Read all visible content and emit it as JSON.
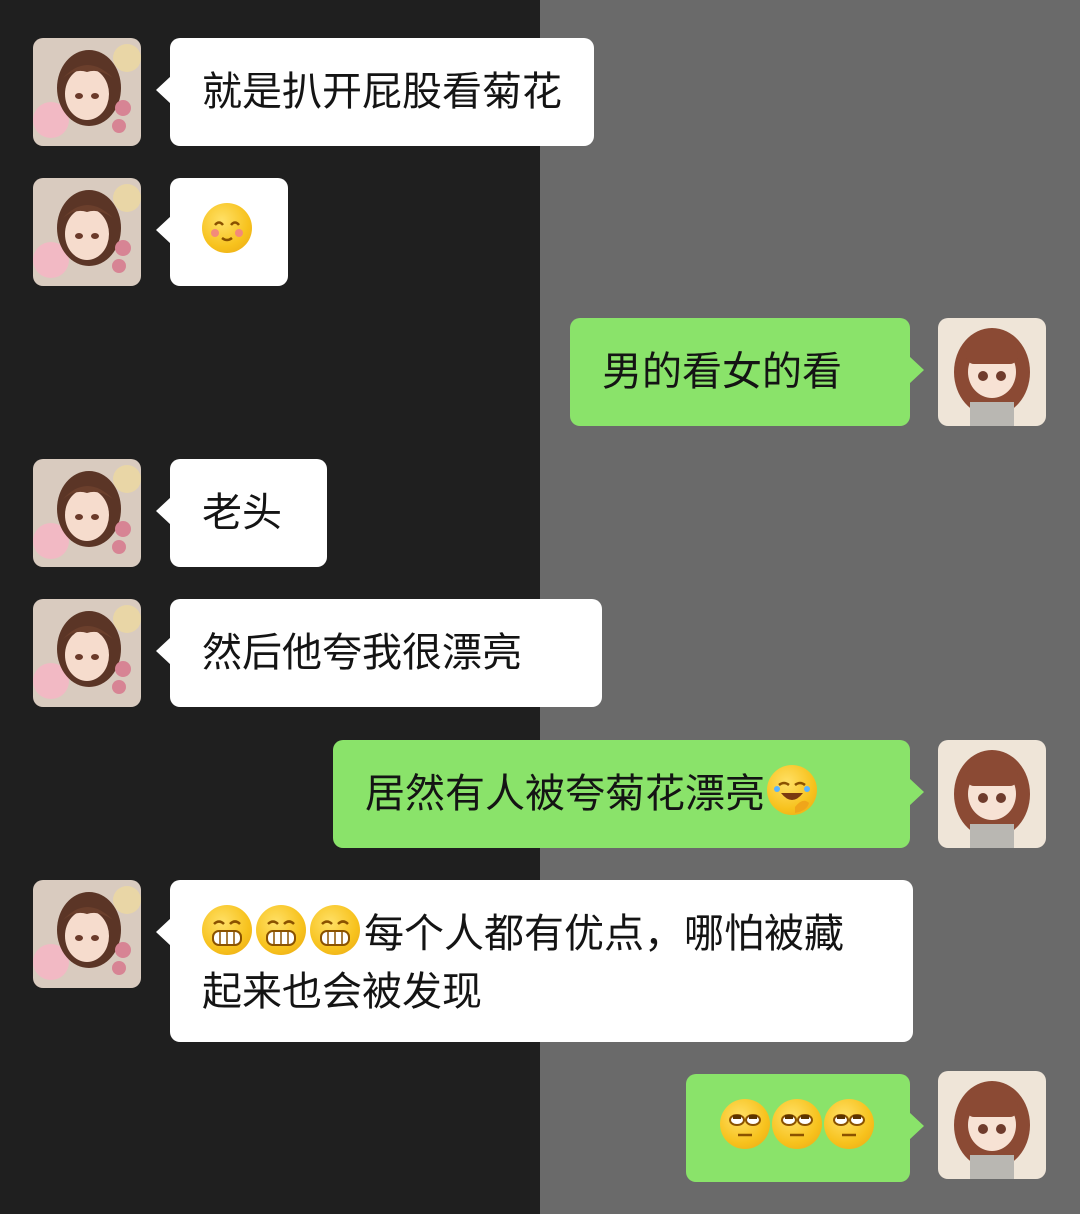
{
  "colors": {
    "left_background": "#1f1f1f",
    "right_background": "#6a6a6a",
    "incoming_bubble": "#ffffff",
    "outgoing_bubble": "#8ae36a",
    "text": "#141414"
  },
  "contacts": {
    "other": {
      "avatar_icon": "anime-girl-avatar-pink-flowers"
    },
    "me": {
      "avatar_icon": "anime-girl-avatar-brown-hair"
    }
  },
  "messages": [
    {
      "side": "incoming",
      "text": "就是扒开屁股看菊花"
    },
    {
      "side": "incoming",
      "emoji": [
        "shy-smile-emoji"
      ]
    },
    {
      "side": "outgoing",
      "text": "男的看女的看"
    },
    {
      "side": "incoming",
      "text": "老头"
    },
    {
      "side": "incoming",
      "text": "然后他夸我很漂亮"
    },
    {
      "side": "outgoing",
      "text": "居然有人被夸菊花漂亮",
      "emoji_after": [
        "facepalm-laugh-emoji"
      ]
    },
    {
      "side": "incoming",
      "emoji_before": [
        "grin-emoji",
        "grin-emoji",
        "grin-emoji"
      ],
      "text": "每个人都有优点，哪怕被藏起来也会被发现"
    },
    {
      "side": "outgoing",
      "emoji": [
        "eye-roll-emoji",
        "eye-roll-emoji",
        "eye-roll-emoji"
      ]
    }
  ]
}
